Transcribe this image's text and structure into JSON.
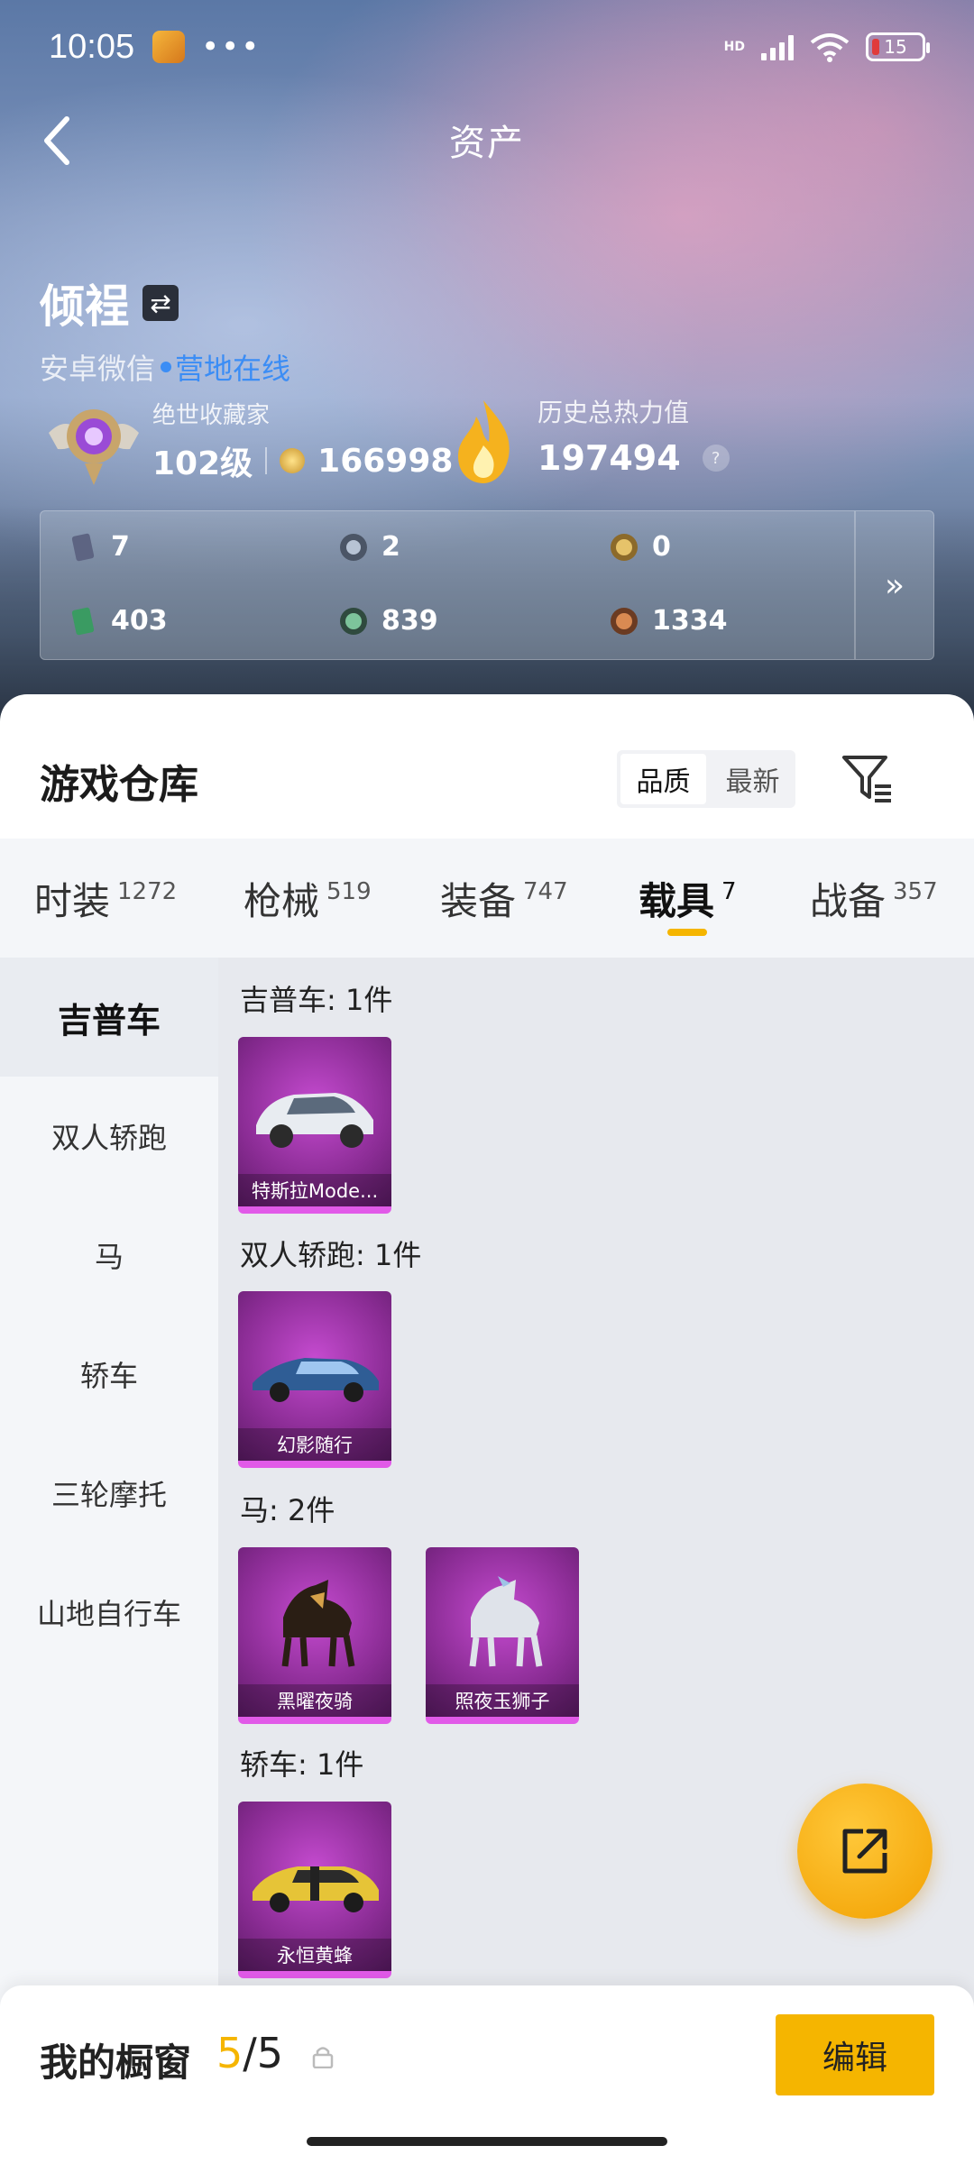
{
  "status_bar": {
    "time": "10:05",
    "dots": "•••",
    "network": "HD",
    "battery": "15"
  },
  "nav": {
    "title": "资产"
  },
  "profile": {
    "name": "倾裎",
    "platform": "安卓微信",
    "online_status": "营地在线"
  },
  "rank": {
    "title": "绝世收藏家",
    "level": "102级",
    "coins": "166998"
  },
  "heat": {
    "title": "历史总热力值",
    "value": "197494",
    "help": "?"
  },
  "stats": [
    {
      "icon": "card-icon",
      "value": "7"
    },
    {
      "icon": "gear-coin-icon",
      "value": "2"
    },
    {
      "icon": "gold-badge-icon",
      "value": "0"
    },
    {
      "icon": "green-card-icon",
      "value": "403"
    },
    {
      "icon": "green-orb-icon",
      "value": "839"
    },
    {
      "icon": "bronze-orb-icon",
      "value": "1334"
    }
  ],
  "stats_more": "»",
  "warehouse": {
    "title": "游戏仓库",
    "sort_options": [
      "品质",
      "最新"
    ],
    "sort_selected": "品质"
  },
  "tabs": [
    {
      "label": "时装",
      "count": "1272"
    },
    {
      "label": "枪械",
      "count": "519"
    },
    {
      "label": "装备",
      "count": "747"
    },
    {
      "label": "载具",
      "count": "7",
      "active": true
    },
    {
      "label": "战备",
      "count": "357"
    }
  ],
  "sidebar": [
    "吉普车",
    "双人轿跑",
    "马",
    "轿车",
    "三轮摩托",
    "山地自行车"
  ],
  "groups": [
    {
      "title": "吉普车: 1件",
      "items": [
        {
          "name": "特斯拉Mode..."
        }
      ]
    },
    {
      "title": "双人轿跑: 1件",
      "items": [
        {
          "name": "幻影随行"
        }
      ]
    },
    {
      "title": "马: 2件",
      "items": [
        {
          "name": "黑曜夜骑"
        },
        {
          "name": "照夜玉狮子"
        }
      ]
    },
    {
      "title": "轿车: 1件",
      "items": [
        {
          "name": "永恒黄蜂"
        }
      ]
    }
  ],
  "showcase": {
    "title": "我的橱窗",
    "current": "5",
    "separator": "/",
    "total": "5",
    "edit_label": "编辑"
  },
  "colors": {
    "accent": "#f5b500",
    "card_purple": "#8a2c94",
    "online_blue": "#3b8df5"
  }
}
